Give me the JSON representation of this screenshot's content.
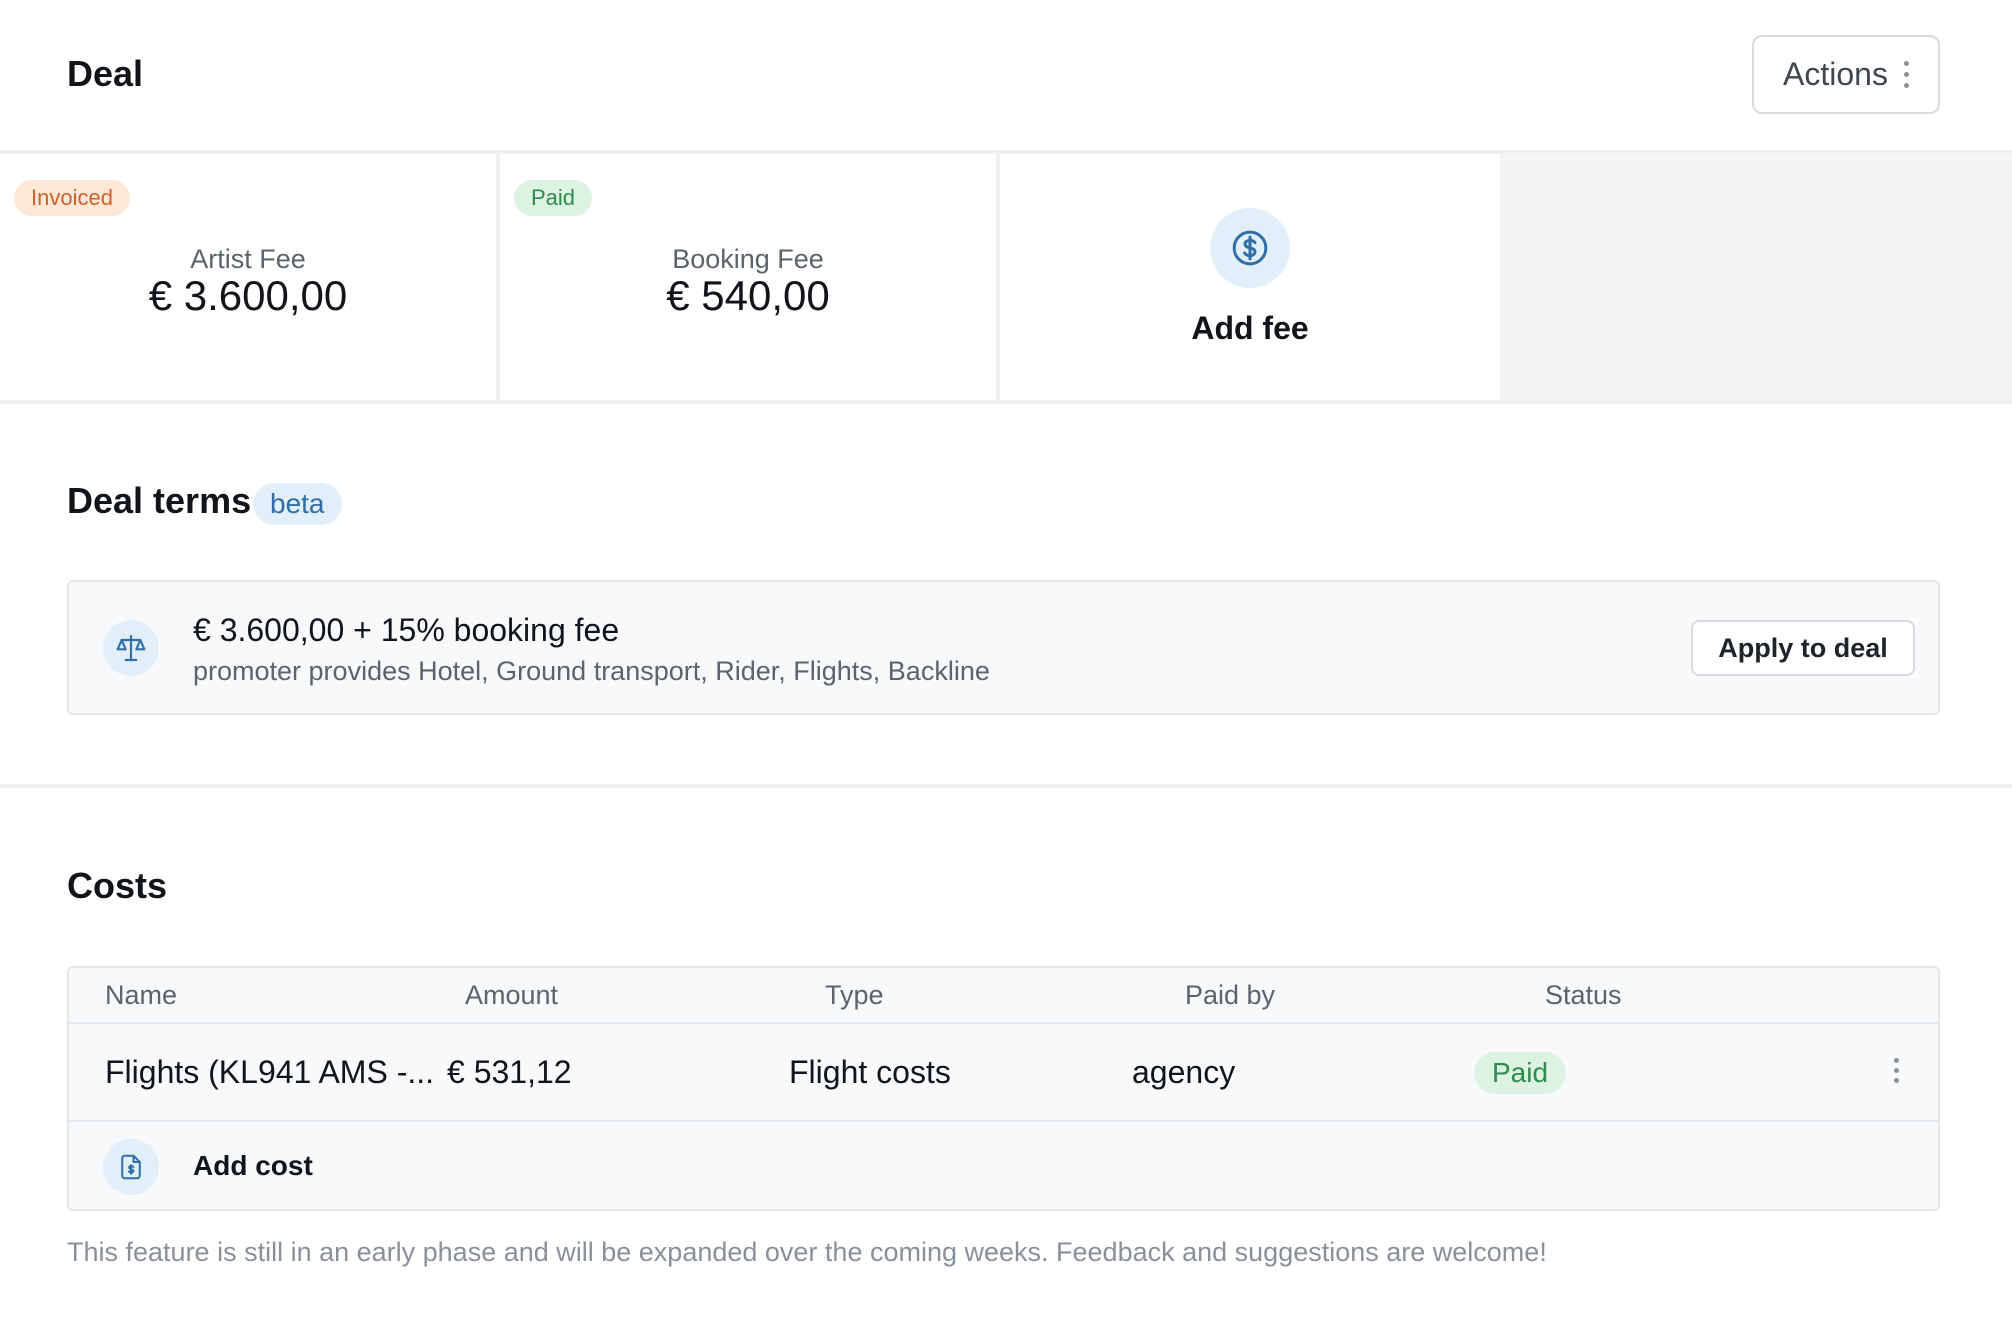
{
  "deal": {
    "title": "Deal",
    "actions_label": "Actions"
  },
  "fees": [
    {
      "badge": "Invoiced",
      "label": "Artist Fee",
      "amount": "€ 3.600,00"
    },
    {
      "badge": "Paid",
      "label": "Booking Fee",
      "amount": "€ 540,00"
    }
  ],
  "add_fee": {
    "label": "Add fee",
    "icon": "dollar-circle-icon"
  },
  "deal_terms": {
    "title": "Deal terms",
    "badge": "beta",
    "icon": "scale-icon",
    "summary": "€ 3.600,00 + 15% booking fee",
    "details": "promoter provides Hotel, Ground transport, Rider, Flights, Backline",
    "apply_label": "Apply to deal"
  },
  "costs": {
    "title": "Costs",
    "columns": [
      "Name",
      "Amount",
      "Type",
      "Paid by",
      "Status"
    ],
    "rows": [
      {
        "name": "Flights (KL941 AMS -...",
        "amount": "€ 531,12",
        "type": "Flight costs",
        "paid_by": "agency",
        "status": "Paid"
      }
    ],
    "add_label": "Add cost",
    "add_icon": "document-dollar-icon"
  },
  "footnote": "This feature is still in an early phase and will be expanded over the coming weeks. Feedback and suggestions are welcome!",
  "colors": {
    "accent": "#2f6fa6",
    "paid": "#2e8b4d",
    "invoiced": "#d2602a"
  }
}
